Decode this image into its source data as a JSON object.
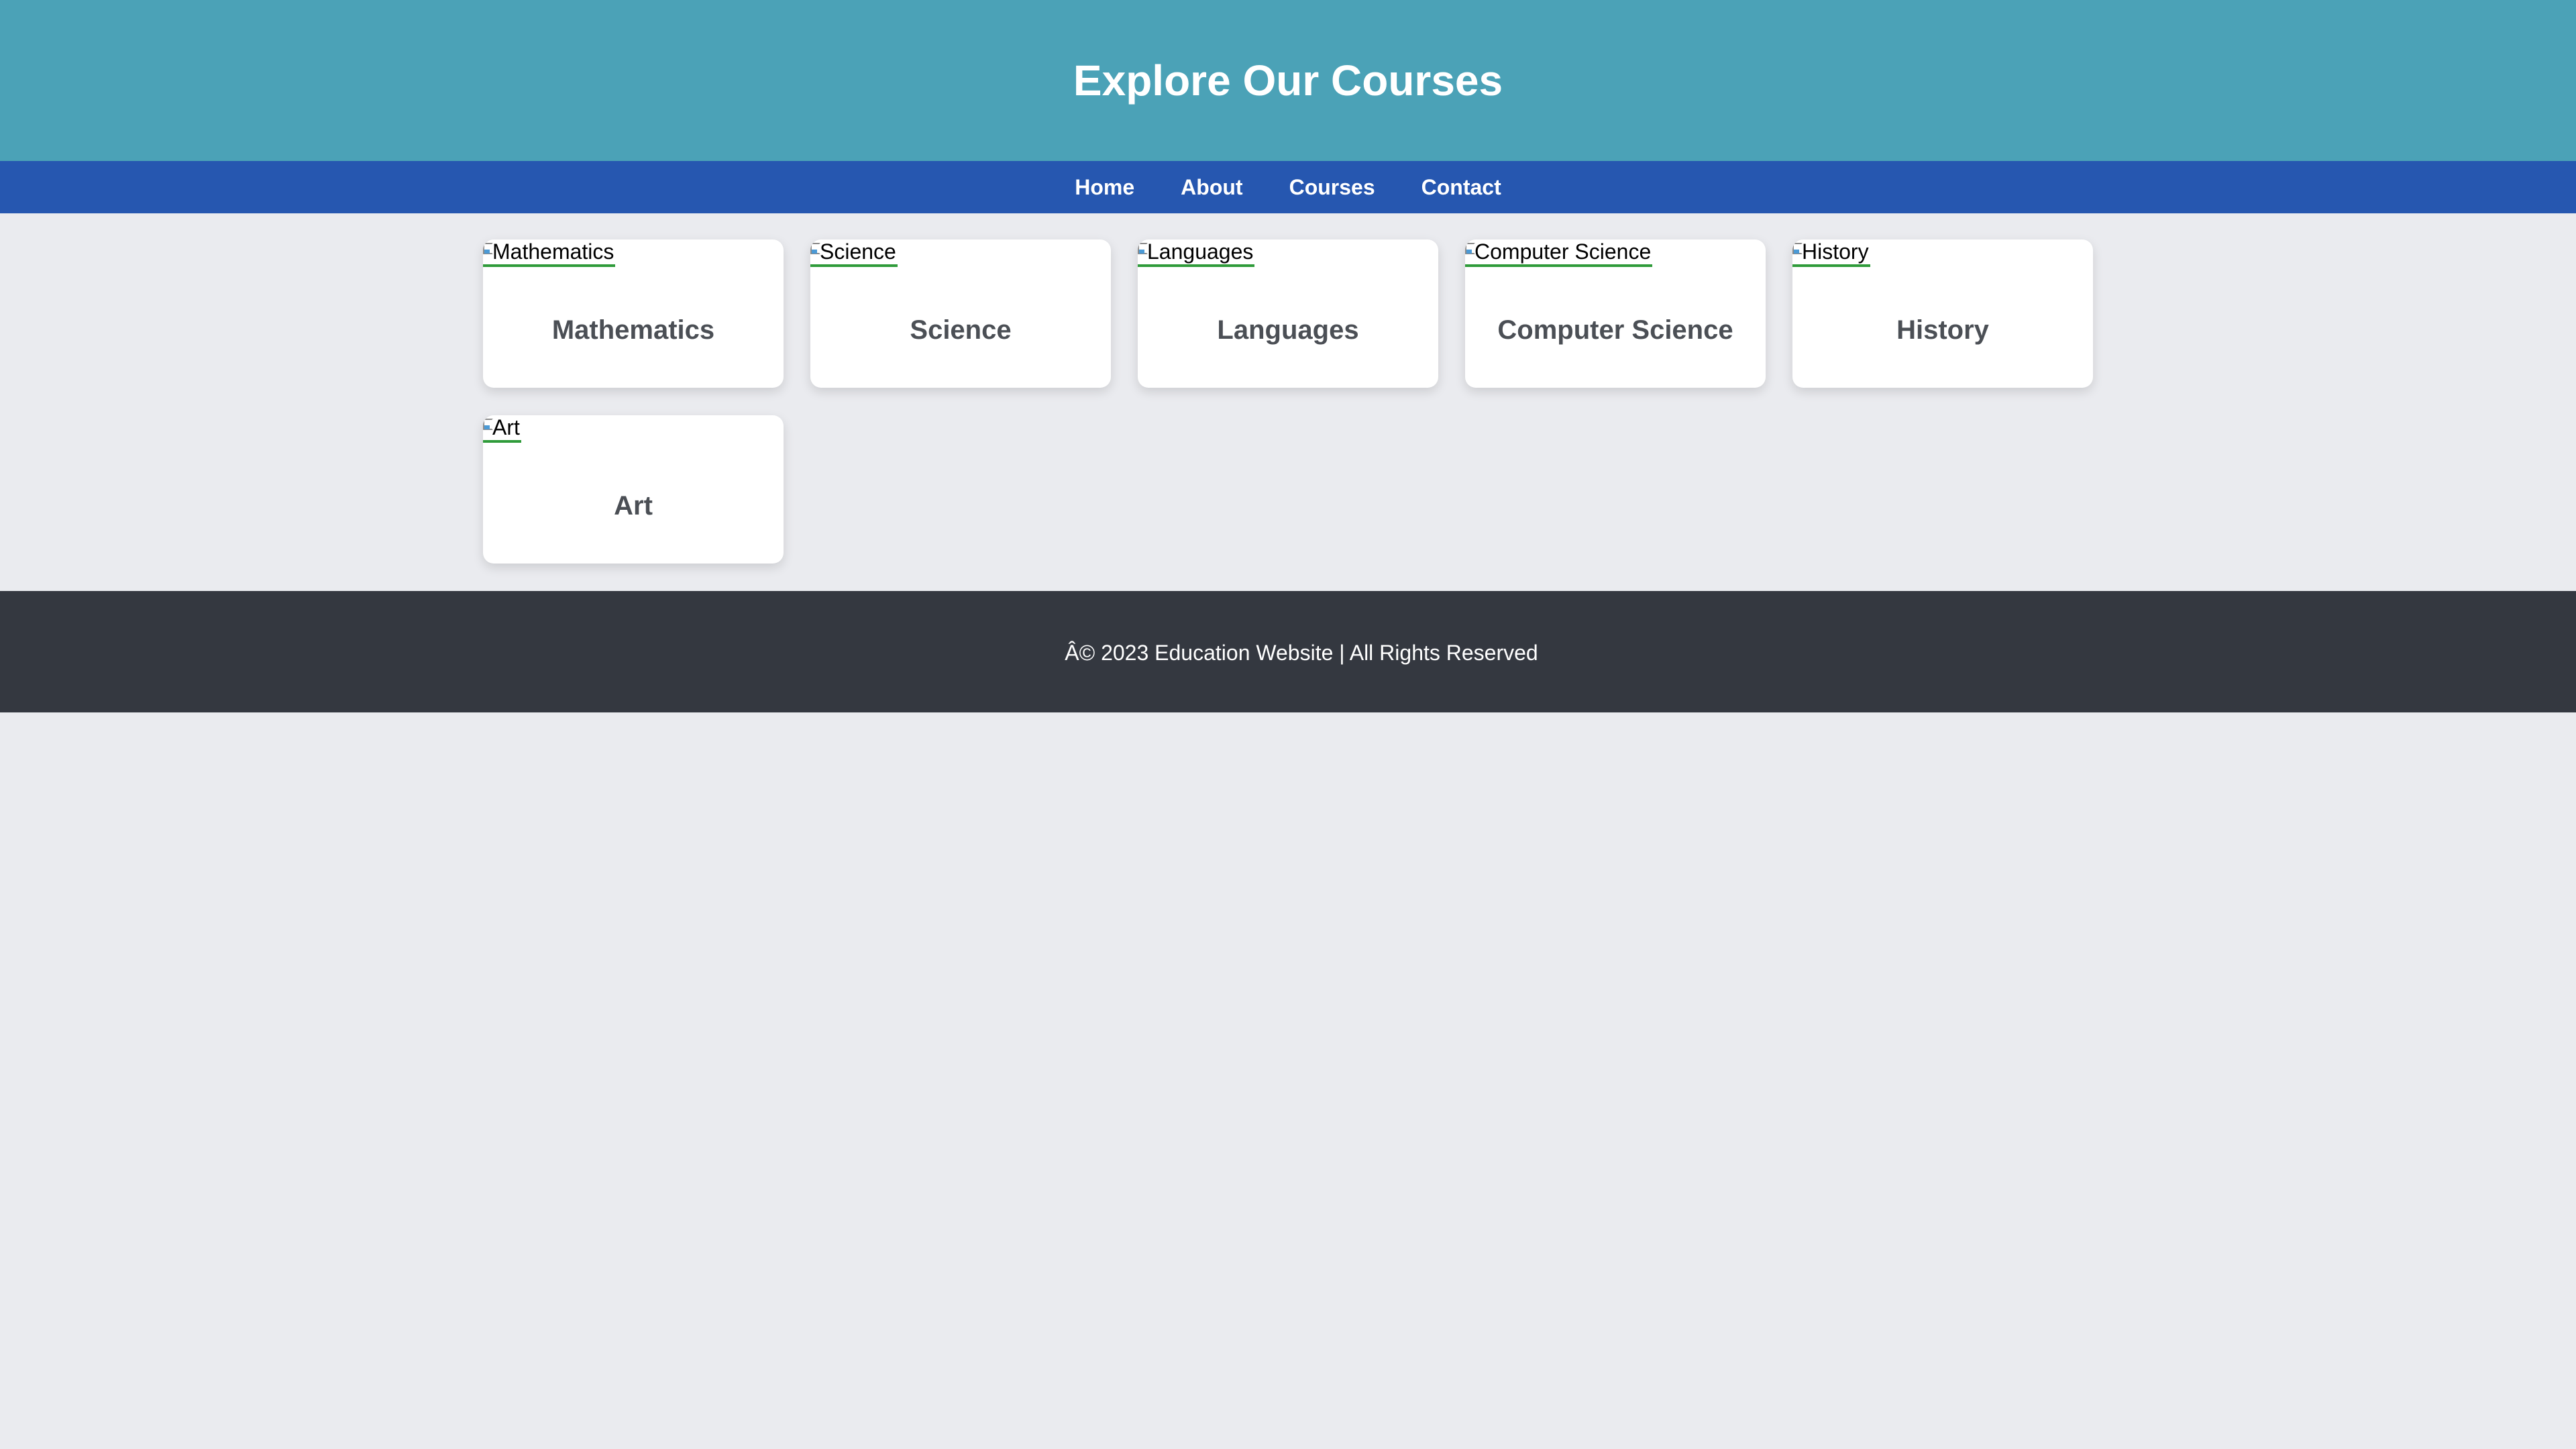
{
  "header": {
    "title": "Explore Our Courses"
  },
  "nav": {
    "items": [
      {
        "label": "Home"
      },
      {
        "label": "About"
      },
      {
        "label": "Courses"
      },
      {
        "label": "Contact"
      }
    ]
  },
  "courses": [
    {
      "image_alt": "Mathematics",
      "title": "Mathematics"
    },
    {
      "image_alt": "Science",
      "title": "Science"
    },
    {
      "image_alt": "Languages",
      "title": "Languages"
    },
    {
      "image_alt": "Computer Science",
      "title": "Computer Science"
    },
    {
      "image_alt": "History",
      "title": "History"
    },
    {
      "image_alt": "Art",
      "title": "Art"
    }
  ],
  "footer": {
    "text": "Â© 2023 Education Website | All Rights Reserved"
  },
  "colors": {
    "header_bg": "#4ba2b7",
    "nav_bg": "#2657b0",
    "page_bg": "#eaebef",
    "footer_bg": "#343840",
    "card_title": "#4b4f55",
    "link_underline": "#2f9b3a"
  },
  "icons": {
    "course_image_placeholder": "broken-image-icon"
  }
}
